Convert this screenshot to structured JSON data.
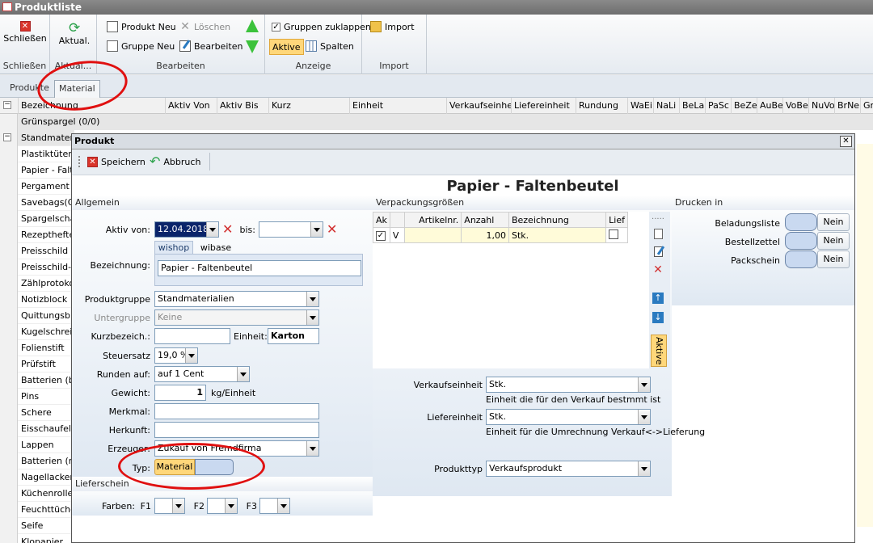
{
  "window": {
    "title": "Produktliste"
  },
  "ribbon": {
    "groups": {
      "schliessen": "Schließen",
      "aktual": "Aktual...",
      "bearbeiten": "Bearbeiten",
      "anzeige": "Anzeige",
      "import": "Import"
    },
    "buttons": {
      "schliessen": "Schließen",
      "aktual": "Aktual.",
      "produkt_neu": "Produkt Neu",
      "loeschen": "Löschen",
      "gruppe_neu": "Gruppe Neu",
      "bearbeiten": "Bearbeiten",
      "gruppen_zuklappen": "Gruppen zuklappen",
      "aktive": "Aktive",
      "spalten": "Spalten",
      "import": "Import"
    }
  },
  "tabs": [
    "Produkte",
    "Material"
  ],
  "grid": {
    "columns": [
      "Bezeichnung",
      "Aktiv Von",
      "Aktiv Bis",
      "Kurz",
      "Einheit",
      "Verkaufseinheit",
      "Liefereinheit",
      "Rundung",
      "WaEi",
      "NaLi",
      "BeLa",
      "PaSc",
      "BeZe",
      "AuBe",
      "VoBe",
      "NuVo",
      "BrNe",
      "Gr"
    ],
    "group1": "Grünspargel (0/0)",
    "rows": [
      "Standmateria",
      "Plastiktüten (",
      "Papier - Falte",
      "Pergament -",
      "Savebags(Ge",
      "Spargelschäl",
      "Rezepthefte",
      "Preisschild",
      "Preisschild-H",
      "Zählprotokoll",
      "Notizblock",
      "Quittungsblo",
      "Kugelschreib",
      "Folienstift",
      "Prüfstift",
      "Batterien (ba",
      "Pins",
      "Schere",
      "Eisschaufel",
      "Lappen",
      "Batterien (m",
      "Nagellackent",
      "Küchenrolle",
      "Feuchttüche",
      "Seife",
      "Klopapier"
    ]
  },
  "dialog": {
    "title": "Produkt",
    "save": "Speichern",
    "cancel": "Abbruch",
    "heading": "Papier - Faltenbeutel",
    "sections": {
      "allgemein": "Allgemein",
      "verpackung": "Verpackungsgrößen",
      "drucken": "Drucken in",
      "lieferschein": "Lieferschein"
    },
    "form": {
      "aktiv_von_label": "Aktiv von:",
      "aktiv_von": "12.04.2018",
      "bis_label": "bis:",
      "bis": "",
      "shop_tabs": [
        "wishop",
        "wibase"
      ],
      "bezeichnung_label": "Bezeichnung:",
      "bezeichnung": "Papier - Faltenbeutel",
      "produktgruppe_label": "Produktgruppe",
      "produktgruppe": "Standmaterialien",
      "untergruppe_label": "Untergruppe",
      "untergruppe": "Keine",
      "kurzbez_label": "Kurzbezeich.:",
      "kurzbez": "",
      "einheit_label": "Einheit:",
      "einheit": "Karton",
      "steuersatz_label": "Steuersatz",
      "steuersatz": "19,0 %",
      "runden_label": "Runden auf:",
      "runden": "auf 1 Cent",
      "gewicht_label": "Gewicht:",
      "gewicht": "1",
      "gewicht_unit": "kg/Einheit",
      "merkmal_label": "Merkmal:",
      "merkmal": "",
      "herkunft_label": "Herkunft:",
      "herkunft": "",
      "erzeuger_label": "Erzeuger:",
      "erzeuger": "Zukauf von Fremdfirma",
      "typ_label": "Typ:",
      "typ": "Material",
      "farben_label": "Farben:",
      "f1": "F1",
      "f2": "F2",
      "f3": "F3"
    },
    "verpackung": {
      "headers": [
        "Ak",
        "",
        "Artikelnr.",
        "Anzahl",
        "Bezeichnung",
        "Lief"
      ],
      "row": {
        "ak": "✓",
        "v": "V",
        "artikelnr": "",
        "anzahl": "1,00",
        "bezeichnung": "Stk."
      },
      "aktive": "Aktive",
      "verkaufseinheit_label": "Verkaufseinheit",
      "verkaufseinheit": "Stk.",
      "verkaufseinheit_hint": "Einheit die für den Verkauf bestmmt ist",
      "liefereinheit_label": "Liefereinheit",
      "liefereinheit": "Stk.",
      "liefereinheit_hint": "Einheit für die Umrechnung Verkauf<->Lieferung",
      "produkttyp_label": "Produkttyp",
      "produkttyp": "Verkaufsprodukt"
    },
    "drucken": {
      "beladungsliste": "Beladungsliste",
      "bestellzettel": "Bestellzettel",
      "packschein": "Packschein",
      "nein": "Nein"
    }
  },
  "colors": {
    "accent_yellow": "#ffd77a",
    "toggle_blue": "#c9d9f0",
    "annotation_red": "#e01010"
  }
}
